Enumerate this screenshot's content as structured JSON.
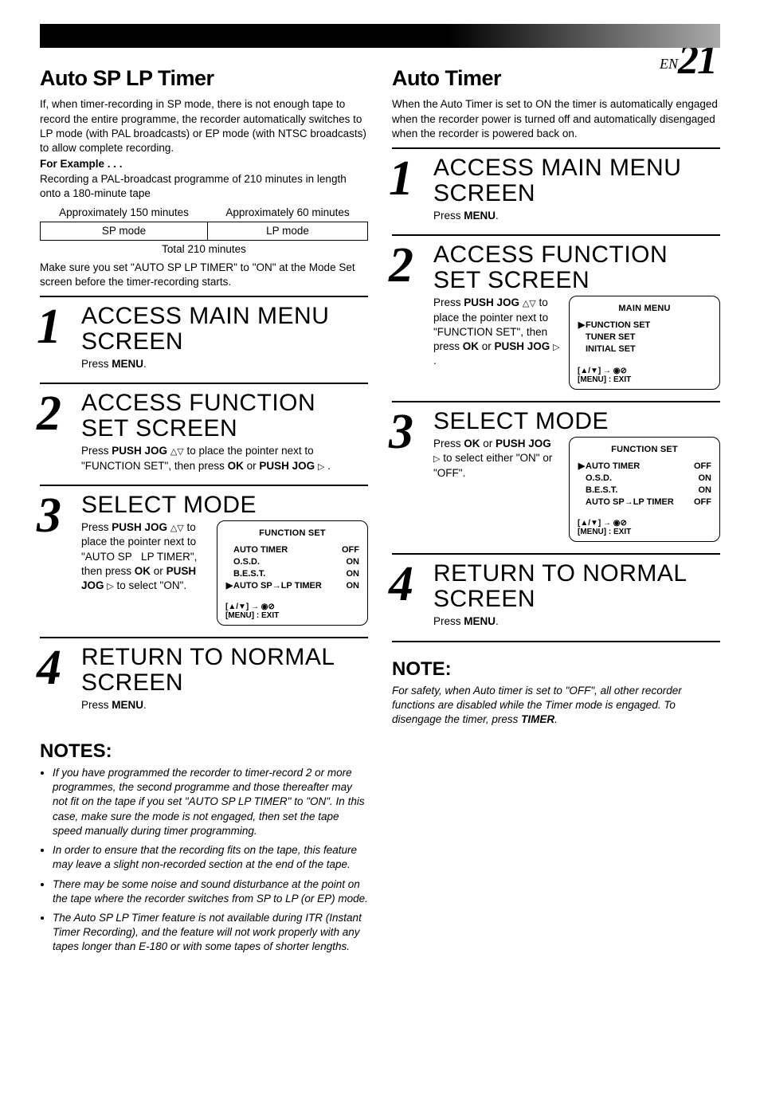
{
  "page_number_prefix": "EN",
  "page_number": "21",
  "left": {
    "title": "Auto SP    LP Timer",
    "intro": "If, when timer-recording in SP mode, there is not enough tape to record the entire programme, the recorder automatically switches to LP mode (with PAL broadcasts) or EP mode (with NTSC broadcasts) to allow complete recording.",
    "for_example_hdr": "For Example . . .",
    "for_example": "Recording a PAL-broadcast programme of 210 minutes in length onto a 180-minute tape",
    "table": {
      "r1c1": "Approximately 150 minutes",
      "r1c2": "Approximately 60 minutes",
      "r2c1": "SP mode",
      "r2c2": "LP mode",
      "total": "Total 210 minutes"
    },
    "after_table": "Make sure you set \"AUTO SP    LP TIMER\" to \"ON\" at the Mode Set screen before the timer-recording starts.",
    "steps": {
      "s1": {
        "title": "ACCESS MAIN MENU SCREEN",
        "text_pre": "Press ",
        "text_key": "MENU",
        "text_post": "."
      },
      "s2": {
        "title": "ACCESS FUNCTION SET SCREEN",
        "line": "Press PUSH JOG △▽ to place the pointer next to \"FUNCTION SET\", then press OK or PUSH JOG ▷ ."
      },
      "s3": {
        "title": "SELECT MODE",
        "line": "Press PUSH JOG △▽ to place the pointer next to \"AUTO SP    LP TIMER\", then press OK or PUSH JOG ▷ to select \"ON\".",
        "osd": {
          "title": "FUNCTION SET",
          "rows": [
            {
              "cursor": "",
              "k": "AUTO TIMER",
              "v": "OFF"
            },
            {
              "cursor": "",
              "k": "O.S.D.",
              "v": "ON"
            },
            {
              "cursor": "",
              "k": "B.E.S.T.",
              "v": "ON"
            },
            {
              "cursor": "▶",
              "k": "AUTO SP→LP TIMER",
              "v": "ON"
            }
          ],
          "foot1": "[▲/▼] → ◉⊘",
          "foot2": "[MENU] : EXIT"
        }
      },
      "s4": {
        "title": "RETURN TO NORMAL SCREEN",
        "text_pre": "Press ",
        "text_key": "MENU",
        "text_post": "."
      }
    },
    "notes_hdr": "NOTES:",
    "notes": [
      "If you have programmed the recorder to timer-record 2 or more programmes, the second programme and those thereafter may not fit on the tape if you set \"AUTO SP    LP TIMER\" to \"ON\". In this case, make sure the mode is not engaged, then set the tape speed manually during timer programming.",
      "In order to ensure that the recording fits on the tape, this feature may leave a slight non-recorded section at the end of the tape.",
      "There may be some noise and sound disturbance at the point on the tape where the recorder switches from SP to LP (or EP) mode.",
      "The Auto SP    LP Timer feature is not available during ITR (Instant Timer Recording), and the feature will not work properly with any tapes longer than E-180 or with some tapes of shorter lengths."
    ]
  },
  "right": {
    "title": "Auto Timer",
    "intro": "When the Auto Timer is set to ON the timer is automatically engaged when the recorder power is turned off and automatically disengaged when the recorder is powered back on.",
    "steps": {
      "s1": {
        "title": "ACCESS MAIN MENU SCREEN",
        "text_pre": "Press ",
        "text_key": "MENU",
        "text_post": "."
      },
      "s2": {
        "title": "ACCESS FUNCTION SET SCREEN",
        "line": "Press PUSH JOG △▽ to place the pointer next to \"FUNCTION SET\", then press OK or PUSH JOG ▷ .",
        "osd": {
          "title": "MAIN MENU",
          "rows": [
            {
              "cursor": "▶",
              "k": "FUNCTION SET",
              "v": ""
            },
            {
              "cursor": "",
              "k": "TUNER SET",
              "v": ""
            },
            {
              "cursor": "",
              "k": "INITIAL SET",
              "v": ""
            }
          ],
          "foot1": "[▲/▼] → ◉⊘",
          "foot2": "[MENU] : EXIT"
        }
      },
      "s3": {
        "title": "SELECT MODE",
        "line": "Press OK or PUSH JOG ▷ to select either \"ON\" or \"OFF\".",
        "osd": {
          "title": "FUNCTION SET",
          "rows": [
            {
              "cursor": "▶",
              "k": "AUTO TIMER",
              "v": "OFF"
            },
            {
              "cursor": "",
              "k": "O.S.D.",
              "v": "ON"
            },
            {
              "cursor": "",
              "k": "B.E.S.T.",
              "v": "ON"
            },
            {
              "cursor": "",
              "k": "AUTO SP→LP TIMER",
              "v": "OFF"
            }
          ],
          "foot1": "[▲/▼] → ◉⊘",
          "foot2": "[MENU] : EXIT"
        }
      },
      "s4": {
        "title": "RETURN TO NORMAL SCREEN",
        "text_pre": "Press ",
        "text_key": "MENU",
        "text_post": "."
      }
    },
    "note_hdr": "NOTE:",
    "note_pre": "For safety, when Auto timer is set to \"OFF\", all other recorder functions are disabled while the Timer mode is engaged. To disengage the timer, press ",
    "note_key": "TIMER",
    "note_post": "."
  }
}
